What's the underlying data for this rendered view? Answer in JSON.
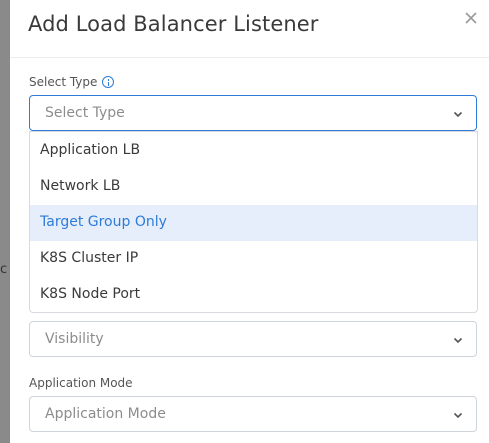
{
  "backdrop": {
    "fragment": "c"
  },
  "modal": {
    "title": "Add Load Balancer Listener",
    "select_type": {
      "label": "Select Type",
      "placeholder": "Select Type",
      "options": [
        {
          "label": "Application LB",
          "highlighted": false
        },
        {
          "label": "Network LB",
          "highlighted": false
        },
        {
          "label": "Target Group Only",
          "highlighted": true
        },
        {
          "label": "K8S Cluster IP",
          "highlighted": false
        },
        {
          "label": "K8S Node Port",
          "highlighted": false
        }
      ]
    },
    "visibility": {
      "placeholder": "Visibility"
    },
    "application_mode": {
      "label": "Application Mode",
      "placeholder": "Application Mode"
    }
  },
  "colors": {
    "accent": "#2f7bd6",
    "highlight_bg": "#e6eefb"
  }
}
